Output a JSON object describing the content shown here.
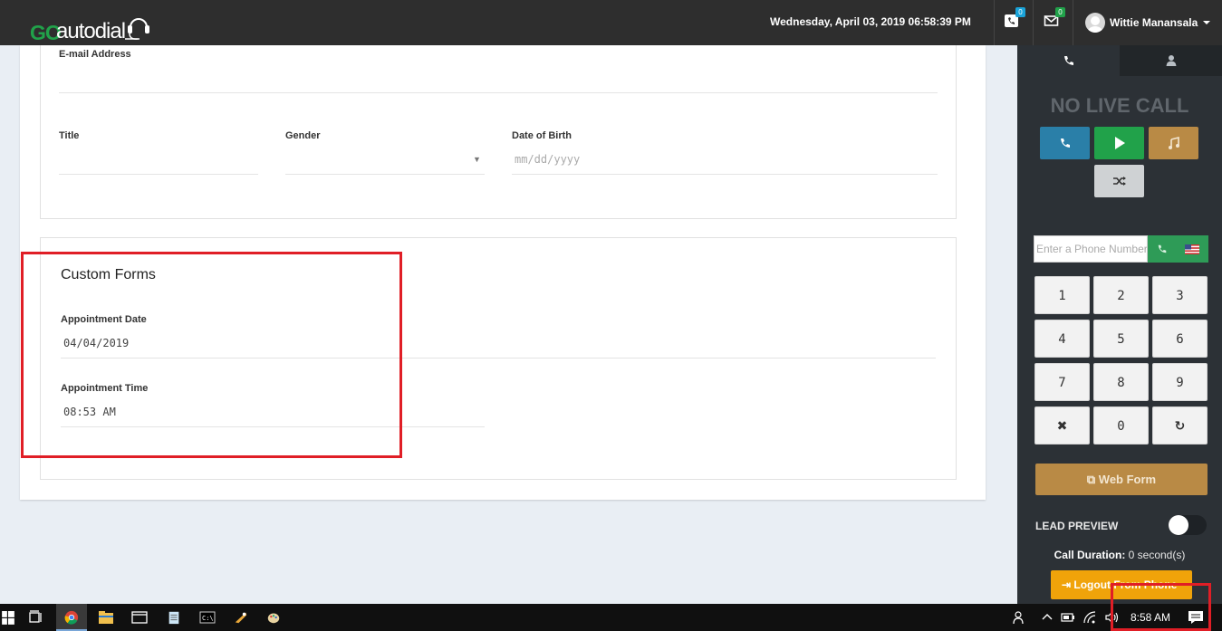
{
  "header": {
    "logo_go": "GO",
    "logo_rest": "autodial",
    "datetime": "Wednesday, April 03, 2019 06:58:39 PM",
    "calls_badge": "0",
    "messages_badge": "0",
    "user_name": "Wittie Manansala",
    "icons": [
      "phone-icon",
      "envelope-icon",
      "avatar-icon",
      "caret-down-icon"
    ]
  },
  "form": {
    "email_label": "E-mail Address",
    "email_value": "",
    "title_label": "Title",
    "gender_label": "Gender",
    "dob_label": "Date of Birth",
    "dob_placeholder": "mm/dd/yyyy"
  },
  "custom_forms": {
    "title": "Custom Forms",
    "appointment_date_label": "Appointment Date",
    "appointment_date_value": "04/04/2019",
    "appointment_time_label": "Appointment Time",
    "appointment_time_value": "08:53 AM"
  },
  "sidebar": {
    "tabs": [
      "phone-icon",
      "user-icon"
    ],
    "status": "NO LIVE CALL",
    "call_buttons": [
      {
        "name": "dial-button",
        "color": "#2a7fa8",
        "icon": "phone-icon"
      },
      {
        "name": "resume-button",
        "color": "#21a24a",
        "icon": "play-icon"
      },
      {
        "name": "music-button",
        "color": "#b98a45",
        "icon": "music-icon"
      },
      {
        "name": "transfer-button",
        "color": "#cfd2d4",
        "icon": "shuffle-icon"
      }
    ],
    "phone_placeholder": "Enter a Phone Number",
    "keypad": [
      "1",
      "2",
      "3",
      "4",
      "5",
      "6",
      "7",
      "8",
      "9",
      "✖",
      "0",
      "↻"
    ],
    "webform_label": "Web Form",
    "lead_preview_label": "LEAD PREVIEW",
    "lead_preview_on": false,
    "call_duration_label": "Call Duration:",
    "call_duration_value": "0 second(s)",
    "logout_label": "Logout From Phone"
  },
  "taskbar": {
    "clock": "8:58 AM",
    "apps": [
      "windows-start-icon",
      "task-view-icon",
      "chrome-icon",
      "file-explorer-icon",
      "window-icon",
      "notepad-icon",
      "cmd-icon",
      "app-icon",
      "paint-icon"
    ],
    "tray": [
      "people-icon",
      "chevron-up-icon",
      "battery-icon",
      "wifi-icon",
      "volume-icon",
      "notifications-icon"
    ]
  },
  "colors": {
    "topbar": "#2e2e2e",
    "sidebar": "#2c3136",
    "highlight": "#e01e26",
    "brand_green": "#21a24a"
  }
}
